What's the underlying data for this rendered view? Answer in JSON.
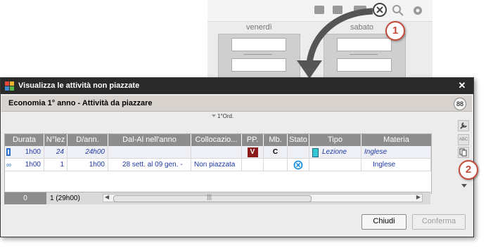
{
  "background_calendar": {
    "days": [
      "venerdì",
      "sabato"
    ]
  },
  "callouts": [
    "1",
    "2"
  ],
  "dialog": {
    "title": "Visualizza le attività non piazzate",
    "subheader": "Economia 1° anno - Attività da piazzare",
    "sort_label": "1°Ord.",
    "columns": [
      "Durata",
      "N°lez",
      "D/ann.",
      "Dal-Al nell'anno",
      "Collocazio...",
      "PP.",
      "Mb.",
      "Stato",
      "Tipo",
      "Materia"
    ],
    "rows": [
      {
        "durata": "1h00",
        "nlez": "24",
        "dann": "24h00",
        "dal_al": "",
        "collocazione": "",
        "pp": "V",
        "mb": "C",
        "stato": "",
        "tipo": "Lezione",
        "materia": "Inglese"
      },
      {
        "durata": "1h00",
        "nlez": "1",
        "dann": "1h00",
        "dal_al": "28 sett. al 09 gen. -",
        "collocazione": "Non piazzata",
        "pp": "",
        "mb": "",
        "stato": "",
        "tipo": "",
        "materia": "Inglese"
      }
    ],
    "status": {
      "count": "0",
      "total": "1 (29h00)"
    },
    "buttons": {
      "close": "Chiudi",
      "confirm": "Conferma"
    }
  },
  "colors": {
    "titlebar": "#2a2a2a",
    "header_cell": "#8d8d8d",
    "pp_badge": "#8b1a1a",
    "callout_ring": "#c44a3a",
    "link_text": "#1e38a6"
  },
  "icons": [
    "filter-icon",
    "search-icon",
    "gear-icon",
    "close-circle-icon",
    "wrench-icon",
    "abc-icon",
    "copy-icon",
    "sort-arrow-icon",
    "link-icon",
    "not-placed-icon"
  ]
}
